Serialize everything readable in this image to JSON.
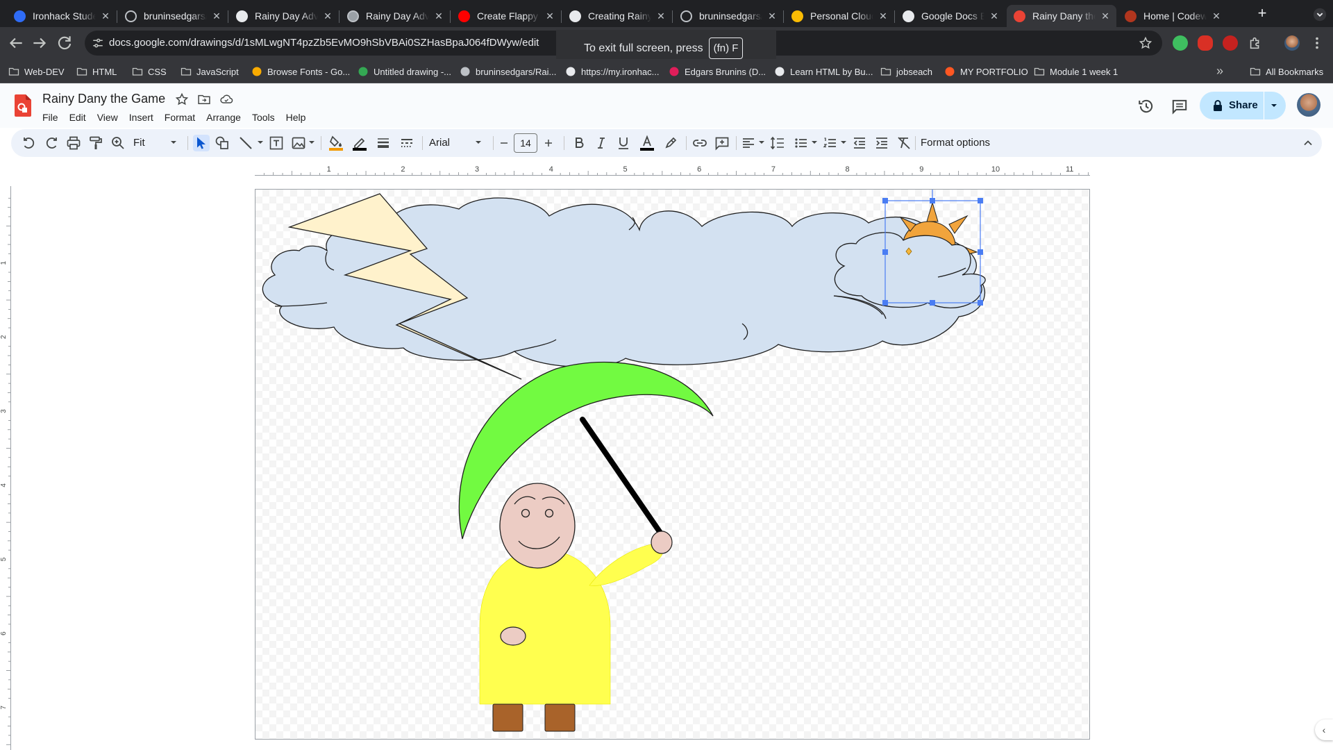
{
  "browser": {
    "tabs": [
      {
        "title": "Ironhack Student Portal",
        "favicon": "ironhack-icon",
        "color": "#2f6cf6",
        "active": false
      },
      {
        "title": "bruninsedgars/Ironhack",
        "favicon": "github-icon",
        "color": "#202124",
        "active": false
      },
      {
        "title": "Rainy Day Adventure",
        "favicon": "chatgpt-icon",
        "color": "#e8eaed",
        "active": false
      },
      {
        "title": "Rainy Day Adventure",
        "favicon": "github-icon",
        "color": "#9aa0a6",
        "active": false
      },
      {
        "title": "Create Flappy Bird",
        "favicon": "youtube-icon",
        "color": "#ff0000",
        "active": false
      },
      {
        "title": "Creating Rainy Day",
        "favicon": "chatgpt-icon",
        "color": "#e8eaed",
        "active": false
      },
      {
        "title": "bruninsedgars/Rainy",
        "favicon": "github-icon",
        "color": "#202124",
        "active": false
      },
      {
        "title": "Personal Cloud Storage",
        "favicon": "drive-icon",
        "color": "#fbbc04",
        "active": false
      },
      {
        "title": "Google Docs Editors Help",
        "favicon": "google-icon",
        "color": "#e8eaed",
        "active": false
      },
      {
        "title": "Rainy Dany the Game",
        "favicon": "drawings-icon",
        "color": "#ea4335",
        "active": true
      },
      {
        "title": "Home | Codewars",
        "favicon": "codewars-icon",
        "color": "#b1361e",
        "active": false
      }
    ],
    "new_tab_label": "+",
    "url": "docs.google.com/drawings/d/1sMLwgNT4pzZb5EvMO9hSbVBAi0SZHasBpaJ064fDWyw/edit",
    "fullscreen_banner": {
      "text": "To exit full screen, press",
      "key": "(fn) F"
    },
    "bookmarks": [
      {
        "label": "Web-DEV",
        "icon": "folder-icon"
      },
      {
        "label": "HTML",
        "icon": "folder-icon"
      },
      {
        "label": "CSS",
        "icon": "folder-icon"
      },
      {
        "label": "JavaScript",
        "icon": "folder-icon"
      },
      {
        "label": "Browse Fonts - Go...",
        "icon": "google-fonts-icon"
      },
      {
        "label": "Untitled drawing -...",
        "icon": "drive-icon"
      },
      {
        "label": "bruninsedgars/Rai...",
        "icon": "github-icon"
      },
      {
        "label": "https://my.ironhac...",
        "icon": "google-icon"
      },
      {
        "label": "Edgars Brunins (D...",
        "icon": "slack-icon"
      },
      {
        "label": "Learn HTML by Bu...",
        "icon": "freecodecamp-icon"
      },
      {
        "label": "jobseach",
        "icon": "folder-icon"
      },
      {
        "label": "MY PORTFOLIO",
        "icon": "blogger-icon"
      },
      {
        "label": "Module 1 week 1",
        "icon": "folder-icon"
      }
    ],
    "bookmarks_more": "»",
    "all_bookmarks": "All Bookmarks"
  },
  "app": {
    "doc_title": "Rainy Dany the Game",
    "menus": [
      "File",
      "Edit",
      "View",
      "Insert",
      "Format",
      "Arrange",
      "Tools",
      "Help"
    ],
    "share_label": "Share",
    "accent": "#c2e7ff"
  },
  "toolbar": {
    "zoom": "Fit",
    "font": "Arial",
    "font_size": "14",
    "format_options": "Format options",
    "fill_color": "#f29900",
    "line_color": "#000000",
    "text_color": "#000000"
  },
  "rulers": {
    "horizontal": [
      "1",
      "2",
      "3",
      "4",
      "5",
      "6",
      "7",
      "8",
      "9",
      "10",
      "11"
    ],
    "vertical": [
      "1",
      "2",
      "3",
      "4",
      "5",
      "6",
      "7"
    ]
  },
  "drawing": {
    "cloud_color": "#d3e1f1",
    "lightning_color": "#fff2cc",
    "umbrella_color": "#72fa41",
    "sun_color": "#f1a43c",
    "face_color": "#ecccc4",
    "body_color": "#ffff4f",
    "boot_color": "#a9632a",
    "selection_color": "#4a7df3"
  }
}
